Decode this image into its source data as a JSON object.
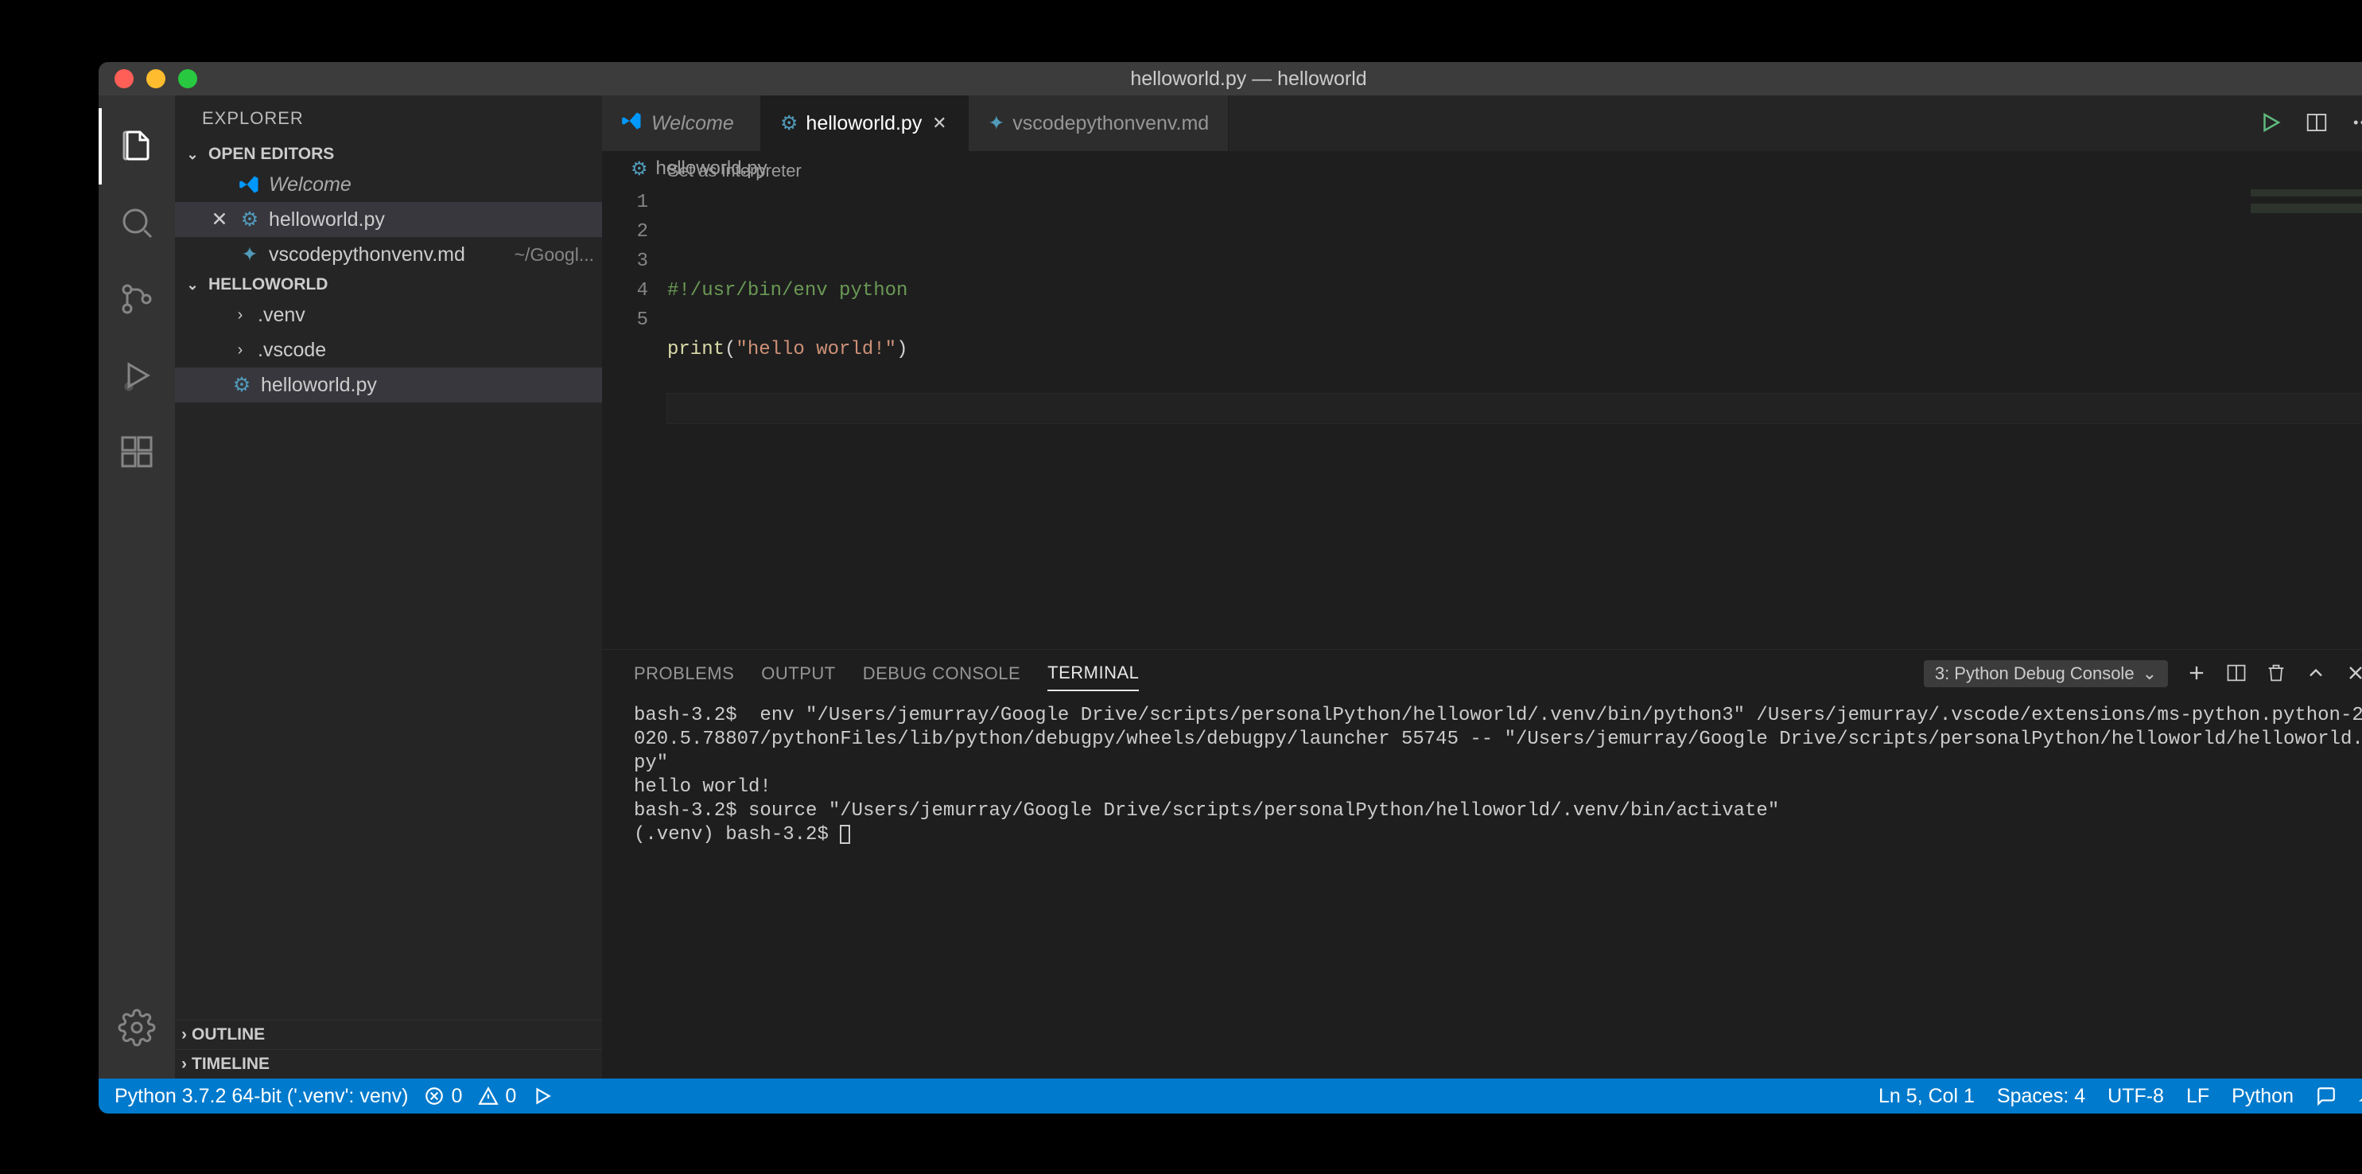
{
  "window": {
    "title": "helloworld.py — helloworld"
  },
  "sidebar": {
    "title": "EXPLORER",
    "open_editors_label": "OPEN EDITORS",
    "open_editors": [
      {
        "label": "Welcome",
        "icon": "vscode",
        "italic": true,
        "dirty": false,
        "closable": false
      },
      {
        "label": "helloworld.py",
        "icon": "python",
        "italic": false,
        "dirty": false,
        "closable": true,
        "active": true
      },
      {
        "label": "vscodepythonvenv.md",
        "icon": "markdown",
        "italic": false,
        "meta": "~/Googl..."
      }
    ],
    "folder_label": "HELLOWORLD",
    "folder_items": [
      {
        "label": ".venv",
        "type": "folder"
      },
      {
        "label": ".vscode",
        "type": "folder"
      },
      {
        "label": "helloworld.py",
        "type": "file",
        "icon": "python",
        "selected": true
      }
    ],
    "outline_label": "OUTLINE",
    "timeline_label": "TIMELINE"
  },
  "tabs": [
    {
      "label": "Welcome",
      "icon": "vscode",
      "italic": true,
      "active": false
    },
    {
      "label": "helloworld.py",
      "icon": "python",
      "active": true,
      "closable": true
    },
    {
      "label": "vscodepythonvenv.md",
      "icon": "markdown",
      "active": false,
      "italic": false
    }
  ],
  "breadcrumb": {
    "icon": "python",
    "label": "helloworld.py"
  },
  "editor": {
    "codelens": "Set as interpreter",
    "lines": [
      {
        "n": 1,
        "tokens": [
          {
            "t": "#!/usr/bin/env python",
            "c": "comment"
          }
        ]
      },
      {
        "n": 2,
        "tokens": []
      },
      {
        "n": 3,
        "tokens": [
          {
            "t": "print",
            "c": "func"
          },
          {
            "t": "(",
            "c": "paren"
          },
          {
            "t": "\"hello world!\"",
            "c": "str"
          },
          {
            "t": ")",
            "c": "paren"
          }
        ]
      },
      {
        "n": 4,
        "tokens": []
      },
      {
        "n": 5,
        "tokens": [],
        "current": true
      }
    ]
  },
  "panel": {
    "tabs": [
      {
        "label": "PROBLEMS"
      },
      {
        "label": "OUTPUT"
      },
      {
        "label": "DEBUG CONSOLE"
      },
      {
        "label": "TERMINAL",
        "active": true
      }
    ],
    "terminal_select": "3: Python Debug Console",
    "terminal_text": "bash-3.2$  env \"/Users/jemurray/Google Drive/scripts/personalPython/helloworld/.venv/bin/python3\" /Users/jemurray/.vscode/extensions/ms-python.python-2020.5.78807/pythonFiles/lib/python/debugpy/wheels/debugpy/launcher 55745 -- \"/Users/jemurray/Google Drive/scripts/personalPython/helloworld/helloworld.py\"\nhello world!\nbash-3.2$ source \"/Users/jemurray/Google Drive/scripts/personalPython/helloworld/.venv/bin/activate\"\n(.venv) bash-3.2$ "
  },
  "statusbar": {
    "python": "Python 3.7.2 64-bit ('.venv': venv)",
    "errors": "0",
    "warnings": "0",
    "position": "Ln 5, Col 1",
    "spaces": "Spaces: 4",
    "encoding": "UTF-8",
    "eol": "LF",
    "language": "Python"
  }
}
